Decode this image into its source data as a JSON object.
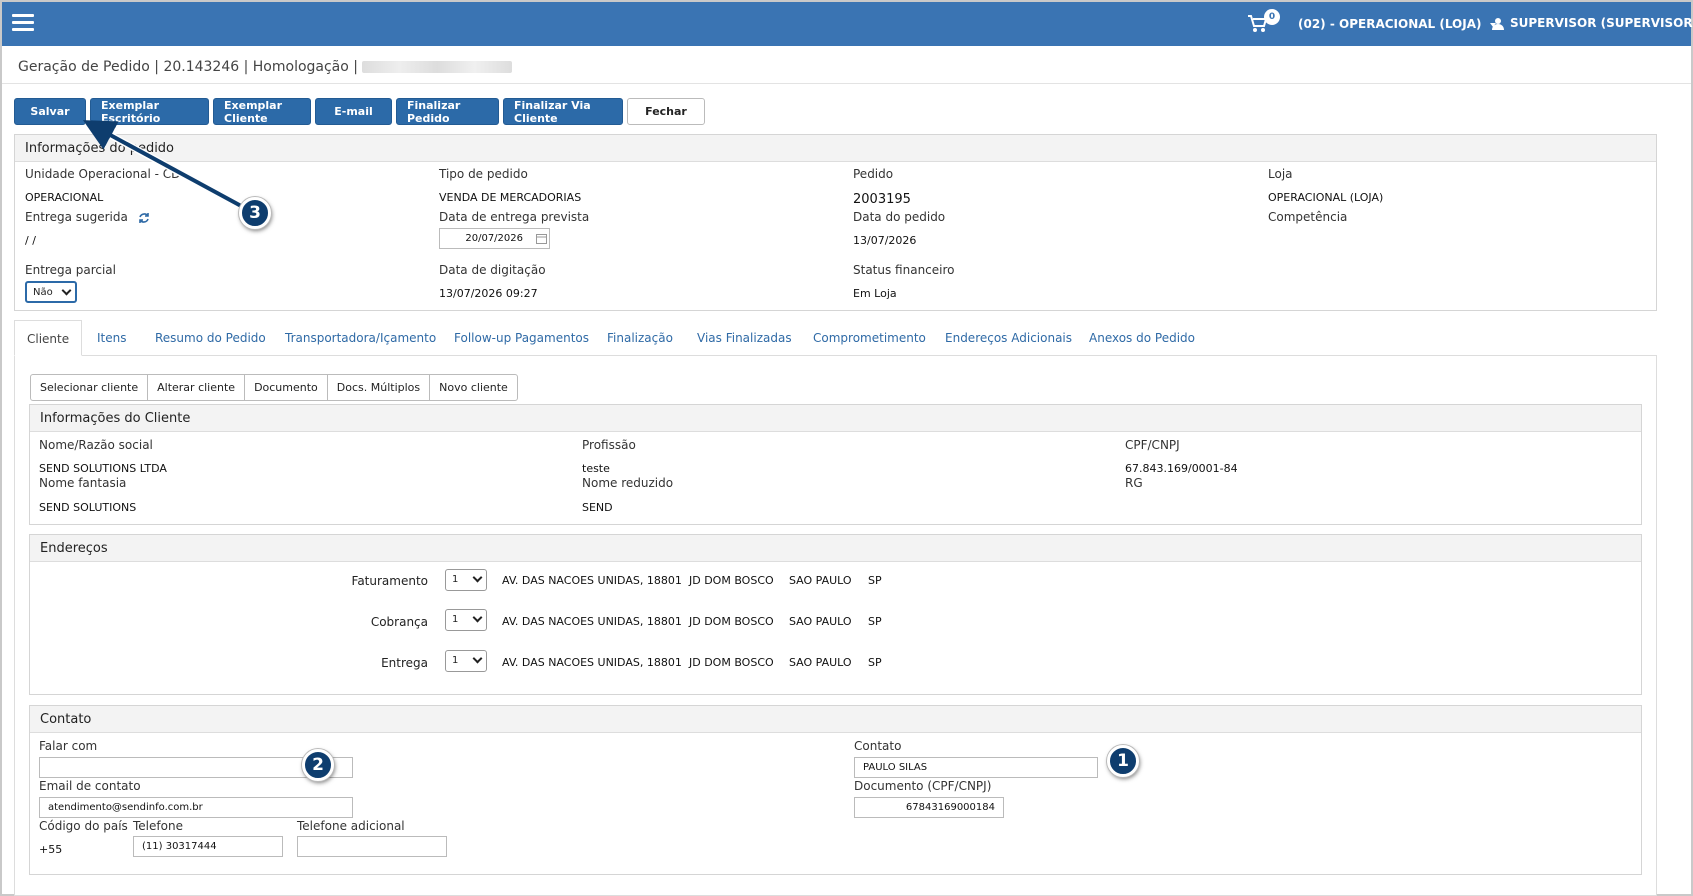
{
  "topbar": {
    "cart_count": "0",
    "unit_label": "(02) - OPERACIONAL (LOJA)",
    "user_label": "SUPERVISOR (SUPERVISOR)"
  },
  "page": {
    "title": "Geração de Pedido | 20.143246 | Homologação |"
  },
  "toolbar": {
    "save": "Salvar",
    "office_copy": "Exemplar Escritório",
    "client_copy": "Exemplar Cliente",
    "email": "E-mail",
    "finish_order": "Finalizar Pedido",
    "finish_client": "Finalizar Via Cliente",
    "close": "Fechar"
  },
  "order_info": {
    "heading": "Informações do pedido",
    "unit_label": "Unidade Operacional - CD",
    "unit_value": "OPERACIONAL",
    "type_label": "Tipo de pedido",
    "type_value": "VENDA DE MERCADORIAS",
    "order_label": "Pedido",
    "order_value": "2003195",
    "store_label": "Loja",
    "store_value": "OPERACIONAL (LOJA)",
    "suggested_label": "Entrega sugerida",
    "suggested_value": "/ /",
    "expected_label": "Data de entrega prevista",
    "expected_value": "20/07/2026",
    "order_date_label": "Data do pedido",
    "order_date_value": "13/07/2026",
    "competence_label": "Competência",
    "partial_label": "Entrega parcial",
    "partial_value": "Não",
    "typed_label": "Data de digitação",
    "typed_value": "13/07/2026 09:27",
    "fin_status_label": "Status financeiro",
    "fin_status_value": "Em Loja"
  },
  "tabs": [
    "Cliente",
    "Itens",
    "Resumo do Pedido",
    "Transportadora/Içamento",
    "Follow-up Pagamentos",
    "Finalização",
    "Vias Finalizadas",
    "Comprometimento",
    "Endereços Adicionais",
    "Anexos do Pedido"
  ],
  "client_buttons": [
    "Selecionar cliente",
    "Alterar cliente",
    "Documento",
    "Docs. Múltiplos",
    "Novo cliente"
  ],
  "client_info": {
    "heading": "Informações do Cliente",
    "name_label": "Nome/Razão social",
    "name_value": "SEND SOLUTIONS LTDA",
    "profession_label": "Profissão",
    "profession_value": "teste",
    "cpf_label": "CPF/CNPJ",
    "cpf_value": "67.843.169/0001-84",
    "fantasy_label": "Nome fantasia",
    "fantasy_value": "SEND SOLUTIONS",
    "short_label": "Nome reduzido",
    "short_value": "SEND",
    "rg_label": "RG"
  },
  "addresses": {
    "heading": "Endereços",
    "rows": [
      {
        "label": "Faturamento",
        "select": "1",
        "street": "AV. DAS NACOES UNIDAS, 18801",
        "district": "JD DOM BOSCO",
        "city": "SAO PAULO",
        "state": "SP"
      },
      {
        "label": "Cobrança",
        "select": "1",
        "street": "AV. DAS NACOES UNIDAS, 18801",
        "district": "JD DOM BOSCO",
        "city": "SAO PAULO",
        "state": "SP"
      },
      {
        "label": "Entrega",
        "select": "1",
        "street": "AV. DAS NACOES UNIDAS, 18801",
        "district": "JD DOM BOSCO",
        "city": "SAO PAULO",
        "state": "SP"
      }
    ]
  },
  "contact": {
    "heading": "Contato",
    "talk_label": "Falar com",
    "talk_value": "",
    "contact_label": "Contato",
    "contact_value": "PAULO SILAS",
    "email_label": "Email de contato",
    "email_value": "atendimento@sendinfo.com.br",
    "doc_label": "Documento (CPF/CNPJ)",
    "doc_value": "67843169000184",
    "country_label": "Código do país",
    "country_value": "+55",
    "phone_label": "Telefone",
    "phone_value": "(11) 30317444",
    "phone2_label": "Telefone adicional",
    "phone2_value": ""
  },
  "callouts": [
    "1",
    "2",
    "3"
  ],
  "colors": {
    "topbar": "#3a74b3",
    "primary_button": "#2c6aa8",
    "callout": "#0e3d6e",
    "tab_link": "#2f6aa6"
  }
}
